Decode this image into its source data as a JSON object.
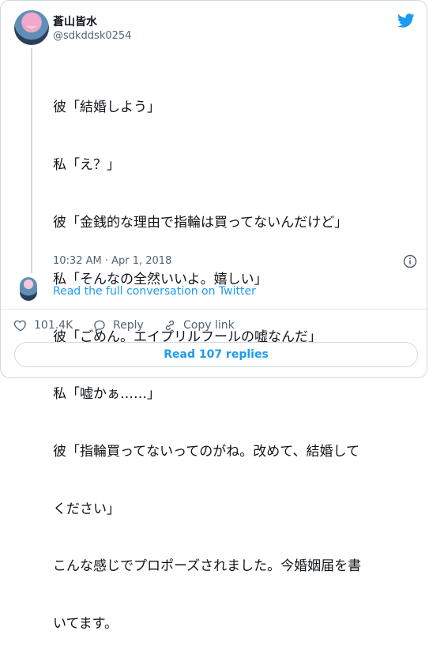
{
  "author": {
    "name": "蒼山皆水",
    "handle": "@sdkddsk0254"
  },
  "tweet": {
    "lines": [
      "彼「結婚しよう」",
      "私「え？」",
      "彼「金銭的な理由で指輪は買ってないんだけど」",
      "私「そんなの全然いいよ。嬉しい」",
      "彼「ごめん。エイプリルフールの嘘なんだ」",
      "私「嘘かぁ……」",
      "彼「指輪買ってないってのがね。改めて、結婚して",
      "ください」",
      "こんな感じでプロポーズされました。今婚姻届を書",
      "いてます。"
    ],
    "timestamp": "10:32 AM · Apr 1, 2018"
  },
  "thread": {
    "full_conversation_label": "Read the full conversation on Twitter"
  },
  "actions": {
    "likes": "101.4K",
    "reply": "Reply",
    "copy_link": "Copy link"
  },
  "read_replies": "Read 107 replies",
  "colors": {
    "accent": "#1d9bf0",
    "text": "#0f1419",
    "muted": "#536471",
    "border": "#cfd9de"
  },
  "icons": {
    "brand": "twitter-bird-icon",
    "info": "info-icon",
    "like": "heart-icon",
    "reply": "reply-icon",
    "copy": "link-icon"
  }
}
